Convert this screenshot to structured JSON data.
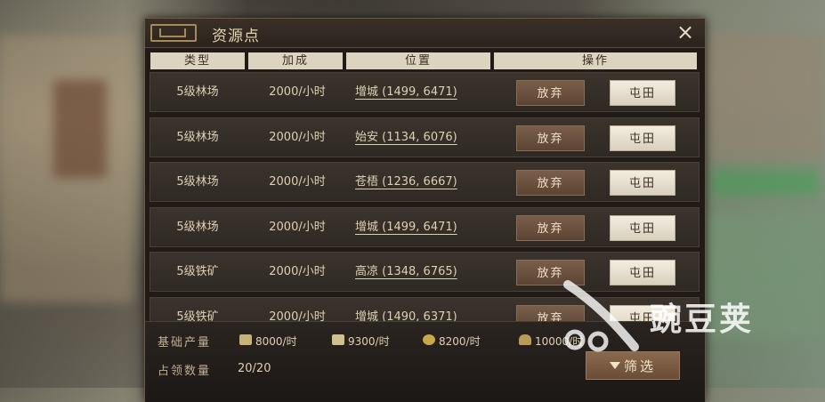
{
  "dialog": {
    "title": "资源点",
    "close_label": "×"
  },
  "table": {
    "headers": [
      "类型",
      "加成",
      "位置",
      "操作"
    ],
    "rows": [
      {
        "type": "5级林场",
        "yield": "2000/小时",
        "location": "增城 (1499, 6471)",
        "abandon": "放弃",
        "farm": "屯田"
      },
      {
        "type": "5级林场",
        "yield": "2000/小时",
        "location": "始安 (1134, 6076)",
        "abandon": "放弃",
        "farm": "屯田"
      },
      {
        "type": "5级林场",
        "yield": "2000/小时",
        "location": "苍梧 (1236, 6667)",
        "abandon": "放弃",
        "farm": "屯田"
      },
      {
        "type": "5级林场",
        "yield": "2000/小时",
        "location": "增城 (1499, 6471)",
        "abandon": "放弃",
        "farm": "屯田"
      },
      {
        "type": "5级铁矿",
        "yield": "2000/小时",
        "location": "高凉 (1348, 6765)",
        "abandon": "放弃",
        "farm": "屯田"
      },
      {
        "type": "5级铁矿",
        "yield": "2000/小时",
        "location": "增城 (1490, 6371)",
        "abandon": "放弃",
        "farm": "屯田"
      }
    ]
  },
  "footer": {
    "base_output_label": "基础产量",
    "resources": [
      {
        "icon": "wood-icon",
        "value": "8000/时",
        "color": "#c8b07a"
      },
      {
        "icon": "iron-icon",
        "value": "9300/时",
        "color": "#d0c090"
      },
      {
        "icon": "stone-icon",
        "value": "8200/时",
        "color": "#c9a84a"
      },
      {
        "icon": "grain-icon",
        "value": "10000/时",
        "color": "#b89a5a"
      }
    ],
    "occupied_label": "占领数量",
    "occupied_value": "20/20",
    "filter_label": "筛选"
  },
  "watermark": {
    "text": "豌豆荚"
  }
}
